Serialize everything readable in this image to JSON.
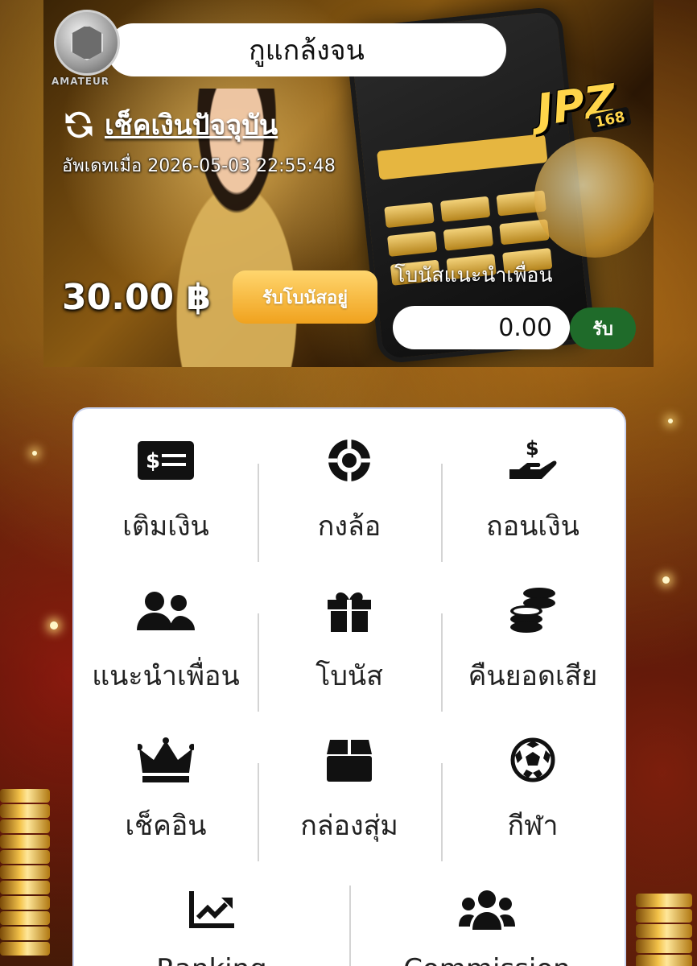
{
  "profile": {
    "username": "กูแกล้งจน",
    "rank_label": "AMATEUR"
  },
  "brand": {
    "name": "JPZ",
    "number": "168"
  },
  "wallet": {
    "refresh_label": "เช็คเงินปัจจุบัน",
    "updated_text": "อัพเดทเมื่อ 2026-05-03 22:55:48",
    "balance": "30.00 ฿",
    "bonus_button": "รับโบนัสอยู่",
    "referral_label": "โบนัสแนะนำเพื่อน",
    "referral_value": "0.00",
    "claim_button": "รับ"
  },
  "menu": [
    {
      "label": "เติมเงิน",
      "icon": "deposit-card-icon"
    },
    {
      "label": "กงล้อ",
      "icon": "wheel-icon"
    },
    {
      "label": "ถอนเงิน",
      "icon": "withdraw-hand-icon"
    },
    {
      "label": "แนะนำเพื่อน",
      "icon": "users-icon"
    },
    {
      "label": "โบนัส",
      "icon": "gift-icon"
    },
    {
      "label": "คืนยอดเสีย",
      "icon": "coins-icon"
    },
    {
      "label": "เช็คอิน",
      "icon": "crown-icon"
    },
    {
      "label": "กล่องสุ่ม",
      "icon": "box-icon"
    },
    {
      "label": "กีฬา",
      "icon": "soccer-ball-icon"
    },
    {
      "label": "Ranking",
      "icon": "chart-line-icon"
    },
    {
      "label": "Commission",
      "icon": "group-icon"
    }
  ]
}
